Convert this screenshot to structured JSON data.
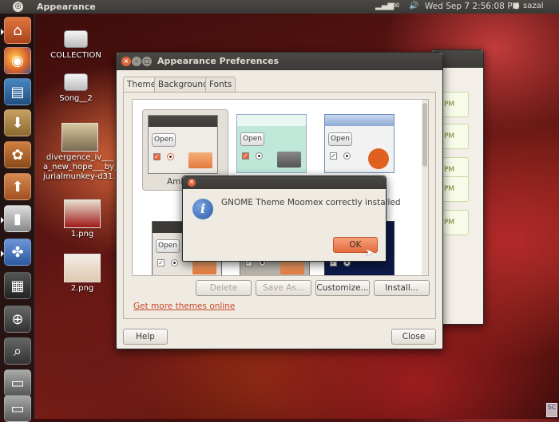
{
  "top_panel": {
    "app_title": "Appearance",
    "datetime": "Wed Sep  7  2:56:08 PM",
    "user": "sazal"
  },
  "launcher": {
    "items": [
      {
        "name": "home-folder",
        "icon": "folder-home-icon",
        "color": "#c15a2e"
      },
      {
        "name": "firefox",
        "icon": "firefox-icon",
        "color": "#d6602a"
      },
      {
        "name": "writer",
        "icon": "document-icon",
        "color": "#2f6aa0"
      },
      {
        "name": "downloads",
        "icon": "download-icon",
        "color": "#9c7a3a"
      },
      {
        "name": "software-center",
        "icon": "bag-icon",
        "color": "#b06030"
      },
      {
        "name": "upload",
        "icon": "upload-icon",
        "color": "#b06030"
      },
      {
        "name": "terminal",
        "icon": "terminal-icon",
        "color": "#666"
      },
      {
        "name": "appearance",
        "icon": "feet-icon",
        "color": "#5a7ab0"
      },
      {
        "name": "workspaces",
        "icon": "workspace-icon",
        "color": "#444"
      },
      {
        "name": "magnifier",
        "icon": "zoom-in-icon",
        "color": "#444"
      },
      {
        "name": "search",
        "icon": "search-icon",
        "color": "#444"
      },
      {
        "name": "drive-1",
        "icon": "drive-icon",
        "color": "#666"
      },
      {
        "name": "drive-2",
        "icon": "drive-icon",
        "color": "#666"
      }
    ]
  },
  "desktop": {
    "icons": [
      {
        "label": "COLLECTION"
      },
      {
        "label": "Song__2"
      },
      {
        "label": "divergence_iv___\na_new_hope___by_\njurialmunkey-d31.."
      },
      {
        "label": "1.png"
      },
      {
        "label": "2.png"
      }
    ]
  },
  "back_window": {
    "pm_labels": [
      "PM",
      "PM",
      "PM",
      "PM",
      "PM"
    ]
  },
  "appearance_window": {
    "title": "Appearance Preferences",
    "tabs": [
      {
        "label": "Theme",
        "active": true
      },
      {
        "label": "Background",
        "active": false
      },
      {
        "label": "Fonts",
        "active": false
      }
    ],
    "themes": [
      {
        "name": "Ambiance",
        "open_label": "Open",
        "selected": true
      },
      {
        "name": "",
        "open_label": "Open"
      },
      {
        "name": "",
        "open_label": "Open"
      },
      {
        "name": "",
        "open_label": "Open"
      }
    ],
    "buttons": {
      "delete": "Delete",
      "save_as": "Save As...",
      "customize": "Customize...",
      "install": "Install...",
      "help": "Help",
      "close": "Close"
    },
    "get_more_link": "Get more themes online"
  },
  "dialog": {
    "message": "GNOME Theme Moomex correctly installed",
    "ok": "OK"
  },
  "visible_fragments": {
    "ambiance_partial": "Amb"
  }
}
